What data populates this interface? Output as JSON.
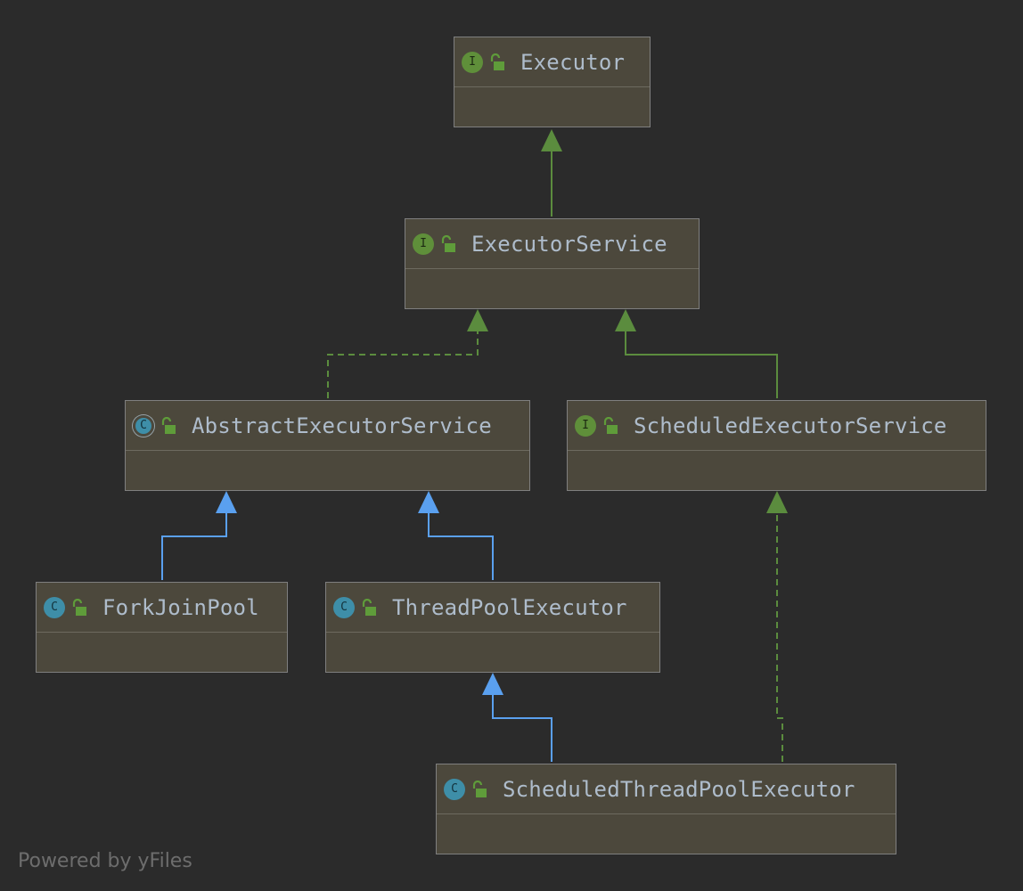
{
  "nodes": [
    {
      "id": "executor",
      "name": "Executor",
      "kind": "interface",
      "kind_letter": "I"
    },
    {
      "id": "executor-service",
      "name": "ExecutorService",
      "kind": "interface",
      "kind_letter": "I"
    },
    {
      "id": "abstract-executor-service",
      "name": "AbstractExecutorService",
      "kind": "abstract",
      "kind_letter": "C"
    },
    {
      "id": "scheduled-executor-service",
      "name": "ScheduledExecutorService",
      "kind": "interface",
      "kind_letter": "I"
    },
    {
      "id": "fork-join-pool",
      "name": "ForkJoinPool",
      "kind": "class",
      "kind_letter": "C"
    },
    {
      "id": "thread-pool-executor",
      "name": "ThreadPoolExecutor",
      "kind": "class",
      "kind_letter": "C"
    },
    {
      "id": "scheduled-thread-pool-executor",
      "name": "ScheduledThreadPoolExecutor",
      "kind": "class",
      "kind_letter": "C"
    }
  ],
  "edges": [
    {
      "from": "executor-service",
      "to": "executor",
      "type": "extends-interface"
    },
    {
      "from": "abstract-executor-service",
      "to": "executor-service",
      "type": "implements"
    },
    {
      "from": "scheduled-executor-service",
      "to": "executor-service",
      "type": "extends-interface"
    },
    {
      "from": "fork-join-pool",
      "to": "abstract-executor-service",
      "type": "extends-class"
    },
    {
      "from": "thread-pool-executor",
      "to": "abstract-executor-service",
      "type": "extends-class"
    },
    {
      "from": "scheduled-thread-pool-executor",
      "to": "thread-pool-executor",
      "type": "extends-class"
    },
    {
      "from": "scheduled-thread-pool-executor",
      "to": "scheduled-executor-service",
      "type": "implements"
    }
  ],
  "colors": {
    "background": "#2b2b2b",
    "node_fill": "#4c483c",
    "interface_edge": "#5b8c3e",
    "class_edge": "#5aa0ef",
    "text": "#aebccb",
    "lock": "#5f9c3a"
  },
  "footer": {
    "text": "Powered by yFiles"
  }
}
